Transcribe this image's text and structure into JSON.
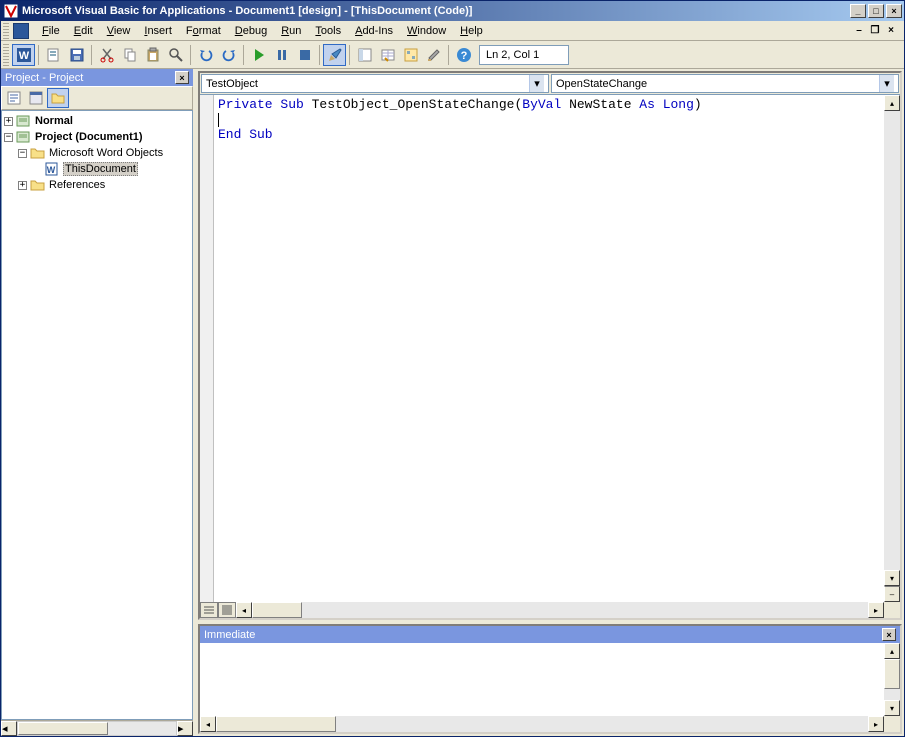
{
  "title": "Microsoft Visual Basic for Applications - Document1 [design] - [ThisDocument (Code)]",
  "menu": {
    "file": "File",
    "edit": "Edit",
    "view": "View",
    "insert": "Insert",
    "format": "Format",
    "debug": "Debug",
    "run": "Run",
    "tools": "Tools",
    "addins": "Add-Ins",
    "window": "Window",
    "help": "Help"
  },
  "toolbar": {
    "status": "Ln 2, Col 1"
  },
  "project_panel": {
    "title": "Project - Project",
    "tree": {
      "normal": "Normal",
      "project": "Project (Document1)",
      "mwo": "Microsoft Word Objects",
      "thisdoc": "ThisDocument",
      "refs": "References"
    }
  },
  "code": {
    "object_combo": "TestObject",
    "proc_combo": "OpenStateChange",
    "line1_pre": "Private Sub",
    "line1_name": " TestObject_OpenStateChange(",
    "line1_byval": "ByVal",
    "line1_mid": " NewState ",
    "line1_as": "As Long",
    "line1_end": ")",
    "line3": "End Sub"
  },
  "immediate": {
    "title": "Immediate"
  }
}
